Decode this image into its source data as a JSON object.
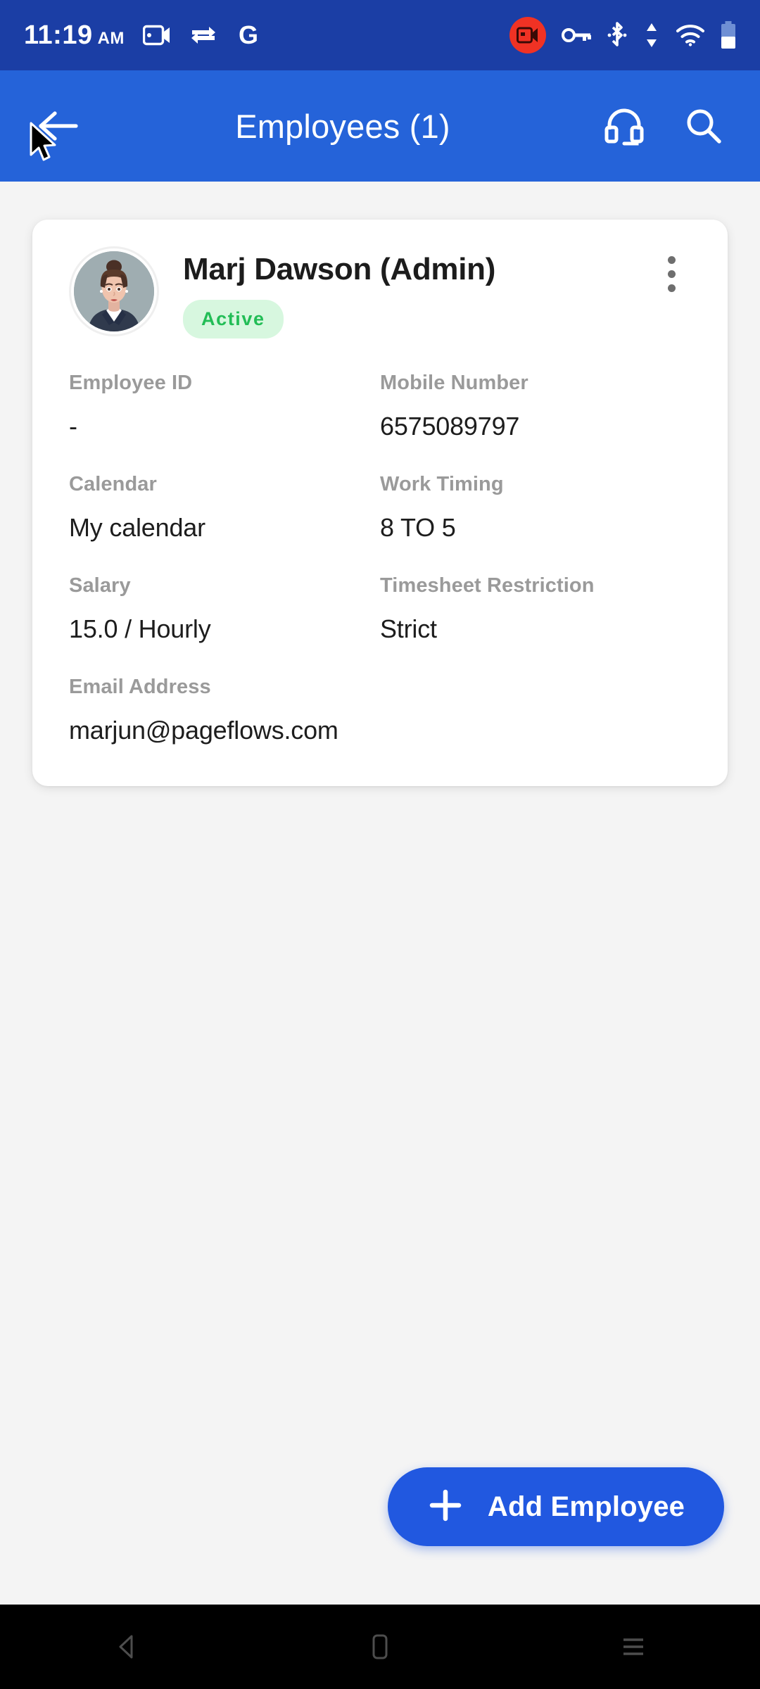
{
  "statusbar": {
    "time": "11:19",
    "ampm": "AM",
    "left_icons": [
      "screen-record-icon",
      "data-transfer-icon",
      "google-icon"
    ],
    "right_icons": [
      "screen-recording-active-icon",
      "vpn-key-icon",
      "bluetooth-icon",
      "data-transfer-arrows-icon",
      "wifi-icon",
      "battery-icon"
    ],
    "background": "#1b3ea5",
    "recording_badge_color": "#f03224"
  },
  "appbar": {
    "back_icon": "arrow-back-icon",
    "title": "Employees (1)",
    "support_icon": "headset-icon",
    "search_icon": "search-icon",
    "background": "#2563d9"
  },
  "employee_card": {
    "avatar": "female-employee-avatar",
    "name": "Marj Dawson (Admin)",
    "status": "Active",
    "status_bg": "#d7f7df",
    "status_color": "#22bd56",
    "overflow_icon": "more-vertical-icon",
    "fields": [
      [
        {
          "label": "Employee ID",
          "value": "-"
        },
        {
          "label": "Mobile Number",
          "value": "6575089797"
        }
      ],
      [
        {
          "label": "Calendar",
          "value": "My calendar"
        },
        {
          "label": "Work Timing",
          "value": "8 TO 5"
        }
      ],
      [
        {
          "label": "Salary",
          "value": "15.0 / Hourly"
        },
        {
          "label": "Timesheet Restriction",
          "value": "Strict"
        }
      ],
      [
        {
          "label": "Email Address",
          "value": "marjun@pageflows.com"
        }
      ]
    ]
  },
  "fab": {
    "icon": "plus-icon",
    "label": "Add Employee",
    "background": "#2158e0"
  },
  "navbar": {
    "back": "nav-back-icon",
    "home": "nav-home-icon",
    "recents": "nav-recents-icon",
    "background": "#000000"
  }
}
